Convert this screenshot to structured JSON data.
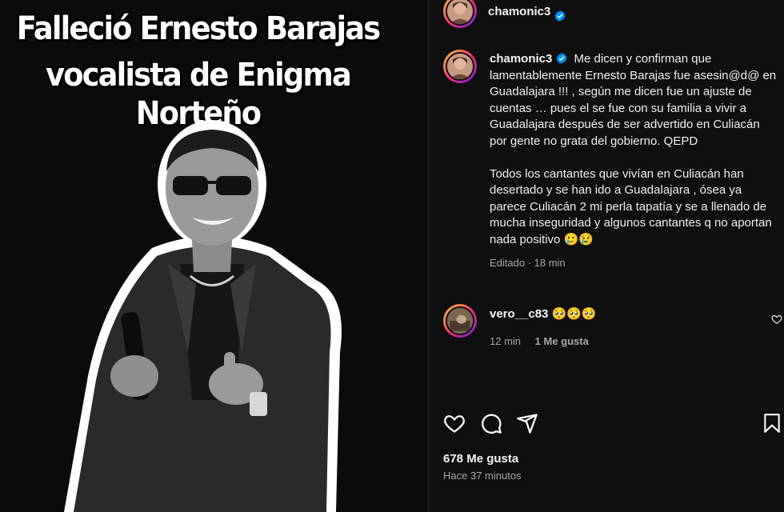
{
  "post_image": {
    "headline_line1": "Falleció Ernesto Barajas",
    "headline_line2": "vocalista de Enigma Norteño"
  },
  "header": {
    "username": "chamonic3",
    "verified_icon": "verified-badge-icon"
  },
  "caption": {
    "username": "chamonic3",
    "paragraph1": "Me dicen y confirman que lamentablemente Ernesto Barajas fue asesin@d@ en Guadalajara !!! , según me dicen fue un ajuste de cuentas … pues el se fue con su familia a vivir a Guadalajara después de ser advertido en Culiacán por gente no grata del gobierno. QEPD",
    "paragraph2": "Todos los cantantes que vivían en Culiacán han desertado y se han ido a Guadalajara , ósea ya parece Culiacán 2 mi perla tapatía y se a llenado de mucha inseguridad y algunos cantantes q no aportan nada positivo 🥲😢",
    "edited": "Editado",
    "time": "18 min"
  },
  "comment": {
    "username": "vero__c83",
    "text": "🥺🥺🥺",
    "time": "12 min",
    "likes": "1 Me gusta"
  },
  "footer": {
    "likes": "678 Me gusta",
    "posted": "Hace 37 minutos"
  },
  "colors": {
    "background": "#000000",
    "panel": "#0f0f0f",
    "muted_text": "#a8a8a8",
    "verified": "#0095f6"
  }
}
